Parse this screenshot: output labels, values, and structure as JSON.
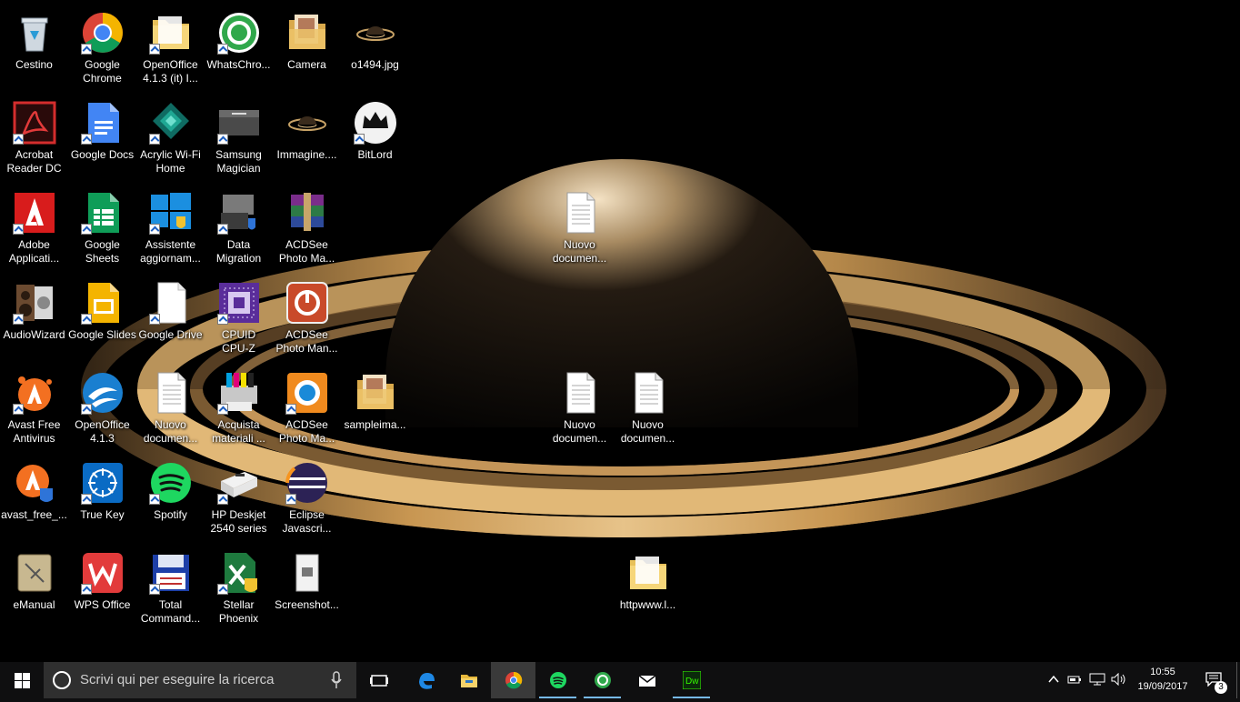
{
  "desktop": {
    "icons": [
      {
        "label": "Cestino",
        "icon": "recycle-bin-icon",
        "shortcut": false
      },
      {
        "label": "Google\nChrome",
        "icon": "chrome-icon",
        "shortcut": true
      },
      {
        "label": "OpenOffice\n4.1.3 (it) I...",
        "icon": "folder-icon",
        "shortcut": true
      },
      {
        "label": "WhatsChro...",
        "icon": "whatschrome-icon",
        "shortcut": true
      },
      {
        "label": "Camera",
        "icon": "folder-photos-icon",
        "shortcut": false
      },
      {
        "label": "o1494.jpg",
        "icon": "image-file-icon",
        "shortcut": false
      },
      {
        "label": "Acrobat\nReader DC",
        "icon": "acrobat-icon",
        "shortcut": true
      },
      {
        "label": "Google Docs",
        "icon": "google-docs-icon",
        "shortcut": true
      },
      {
        "label": "Acrylic Wi-Fi\nHome",
        "icon": "acrylic-wifi-icon",
        "shortcut": true
      },
      {
        "label": "Samsung\nMagician",
        "icon": "samsung-ssd-icon",
        "shortcut": true
      },
      {
        "label": "Immagine....",
        "icon": "image-file-icon",
        "shortcut": false
      },
      {
        "label": "BitLord",
        "icon": "bitlord-icon",
        "shortcut": true
      },
      {
        "label": "Adobe\nApplicati...",
        "icon": "adobe-icon",
        "shortcut": true
      },
      {
        "label": "Google\nSheets",
        "icon": "google-sheets-icon",
        "shortcut": true
      },
      {
        "label": "Assistente\naggiornam...",
        "icon": "windows-update-icon",
        "shortcut": true
      },
      {
        "label": "Data\nMigration",
        "icon": "data-migration-icon",
        "shortcut": true
      },
      {
        "label": "ACDSee\nPhoto Ma...",
        "icon": "winrar-icon",
        "shortcut": false
      },
      {
        "label": "Nuovo\ndocumen...",
        "icon": "text-document-icon",
        "shortcut": false
      },
      {
        "label": "AudioWizard",
        "icon": "audiowizard-icon",
        "shortcut": true
      },
      {
        "label": "Google Slides",
        "icon": "google-slides-icon",
        "shortcut": true
      },
      {
        "label": "Google Drive",
        "icon": "blank-document-icon",
        "shortcut": true
      },
      {
        "label": "CPUID\nCPU-Z",
        "icon": "cpuz-icon",
        "shortcut": true
      },
      {
        "label": "ACDSee\nPhoto Man...",
        "icon": "acdsee-power-icon",
        "shortcut": false
      },
      {
        "label": "Avast Free\nAntivirus",
        "icon": "avast-icon",
        "shortcut": true
      },
      {
        "label": "OpenOffice\n4.1.3",
        "icon": "openoffice-icon",
        "shortcut": true
      },
      {
        "label": "Nuovo\ndocumen...",
        "icon": "text-document-icon",
        "shortcut": false
      },
      {
        "label": "Acquista\nmateriali ...",
        "icon": "printer-supplies-icon",
        "shortcut": true
      },
      {
        "label": "ACDSee\nPhoto Ma...",
        "icon": "acdsee-photo-icon",
        "shortcut": true
      },
      {
        "label": "sampleima...",
        "icon": "folder-photos-icon",
        "shortcut": false
      },
      {
        "label": "Nuovo\ndocumen...",
        "icon": "text-document-icon",
        "shortcut": false
      },
      {
        "label": "Nuovo\ndocumen...",
        "icon": "text-document-icon",
        "shortcut": false
      },
      {
        "label": "avast_free_...",
        "icon": "avast-installer-icon",
        "shortcut": false
      },
      {
        "label": "True Key",
        "icon": "truekey-icon",
        "shortcut": true
      },
      {
        "label": "Spotify",
        "icon": "spotify-icon",
        "shortcut": true
      },
      {
        "label": "HP Deskjet\n2540 series",
        "icon": "hp-printer-icon",
        "shortcut": true
      },
      {
        "label": "Eclipse\nJavascri...",
        "icon": "eclipse-icon",
        "shortcut": true
      },
      {
        "label": "eManual",
        "icon": "emanual-icon",
        "shortcut": false
      },
      {
        "label": "WPS Office",
        "icon": "wps-office-icon",
        "shortcut": true
      },
      {
        "label": "Total\nCommand...",
        "icon": "total-commander-icon",
        "shortcut": true
      },
      {
        "label": "Stellar\nPhoenix Exc...",
        "icon": "stellar-excel-icon",
        "shortcut": true
      },
      {
        "label": "Screenshot...",
        "icon": "screenshot-file-icon",
        "shortcut": false
      },
      {
        "label": "httpwww.l...",
        "icon": "folder-icon",
        "shortcut": false
      }
    ]
  },
  "taskbar": {
    "search_placeholder": "Scrivi qui per eseguire la ricerca",
    "pinned": [
      {
        "name": "task-view",
        "icon": "task-view-icon"
      },
      {
        "name": "edge",
        "icon": "edge-icon"
      },
      {
        "name": "file-explorer",
        "icon": "file-explorer-icon"
      },
      {
        "name": "chrome",
        "icon": "chrome-icon",
        "state": "active"
      },
      {
        "name": "spotify",
        "icon": "spotify-icon",
        "state": "running"
      },
      {
        "name": "whatschrome",
        "icon": "whatschrome-icon",
        "state": "running"
      },
      {
        "name": "mail",
        "icon": "mail-icon"
      },
      {
        "name": "dreamweaver",
        "icon": "dreamweaver-icon",
        "state": "running"
      }
    ],
    "clock": {
      "time": "10:55",
      "date": "19/09/2017"
    },
    "notifications_count": "3",
    "colors": {
      "taskbar": "#0f0f10",
      "search": "#2f2f2f",
      "accent": "#76b9ed"
    }
  }
}
